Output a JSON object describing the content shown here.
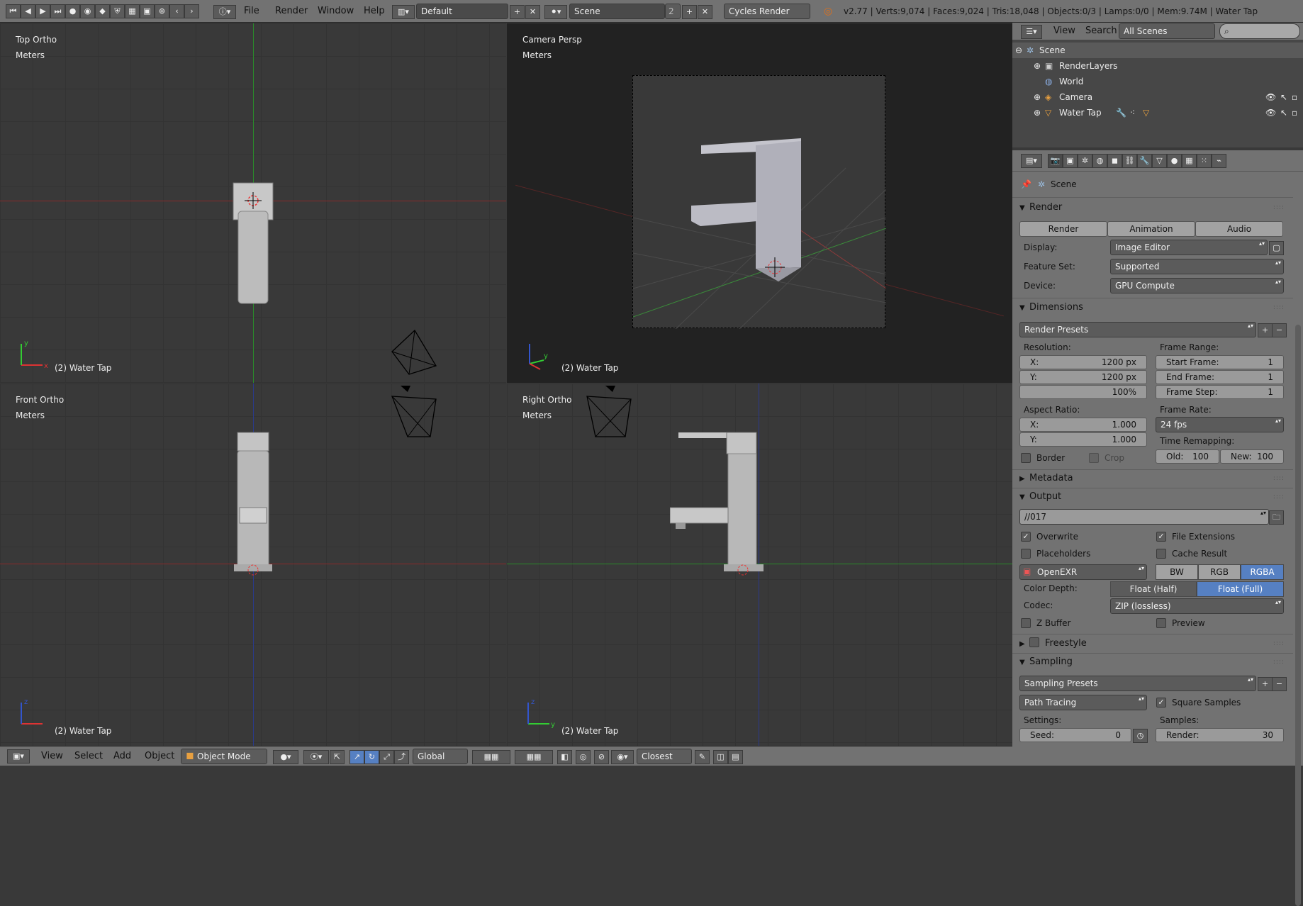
{
  "topbar": {
    "menus": [
      "File",
      "Render",
      "Window",
      "Help"
    ],
    "screen_layout": "Default",
    "scene_name": "Scene",
    "scene_users": "2",
    "render_engine": "Cycles Render",
    "stats": "v2.77 | Verts:9,074 | Faces:9,024 | Tris:18,048 | Objects:0/3 | Lamps:0/0 | Mem:9.74M | Water Tap"
  },
  "viewports": {
    "top_left": {
      "view": "Top Ortho",
      "units": "Meters",
      "object": "(2) Water Tap"
    },
    "top_right": {
      "view": "Camera Persp",
      "units": "Meters",
      "object": "(2) Water Tap"
    },
    "bottom_left": {
      "view": "Front Ortho",
      "units": "Meters",
      "object": "(2) Water Tap"
    },
    "bottom_right": {
      "view": "Right Ortho",
      "units": "Meters",
      "object": "(2) Water Tap"
    }
  },
  "bottombar": {
    "menus": [
      "View",
      "Select",
      "Add",
      "Object"
    ],
    "mode": "Object Mode",
    "orientation": "Global",
    "snap": "Closest"
  },
  "outliner": {
    "menus": [
      "View",
      "Search"
    ],
    "filter": "All Scenes",
    "items": [
      {
        "label": "Scene",
        "icon": "scene-icon"
      },
      {
        "label": "RenderLayers",
        "icon": "render-layers-icon"
      },
      {
        "label": "World",
        "icon": "world-icon"
      },
      {
        "label": "Camera",
        "icon": "camera-icon"
      },
      {
        "label": "Water Tap",
        "icon": "mesh-icon"
      }
    ]
  },
  "properties": {
    "context": "Scene",
    "render": {
      "title": "Render",
      "buttons": [
        "Render",
        "Animation",
        "Audio"
      ],
      "display_label": "Display:",
      "display": "Image Editor",
      "feature_label": "Feature Set:",
      "feature": "Supported",
      "device_label": "Device:",
      "device": "GPU Compute"
    },
    "dimensions": {
      "title": "Dimensions",
      "presets": "Render Presets",
      "resolution_label": "Resolution:",
      "res_x_k": "X:",
      "res_x": "1200 px",
      "res_y_k": "Y:",
      "res_y": "1200 px",
      "res_pct": "100%",
      "frame_range_label": "Frame Range:",
      "start_k": "Start Frame:",
      "start": "1",
      "end_k": "End Frame:",
      "end": "1",
      "step_k": "Frame Step:",
      "step": "1",
      "aspect_label": "Aspect Ratio:",
      "asp_x_k": "X:",
      "asp_x": "1.000",
      "asp_y_k": "Y:",
      "asp_y": "1.000",
      "frame_rate_label": "Frame Rate:",
      "fps": "24 fps",
      "time_remap_label": "Time Remapping:",
      "old_k": "Old:",
      "old": "100",
      "new_k": "New:",
      "new": "100",
      "border": "Border",
      "crop": "Crop"
    },
    "metadata": {
      "title": "Metadata"
    },
    "output": {
      "title": "Output",
      "path": "//017",
      "overwrite": "Overwrite",
      "file_ext": "File Extensions",
      "placeholders": "Placeholders",
      "cache": "Cache Result",
      "format": "OpenEXR",
      "channels": [
        "BW",
        "RGB",
        "RGBA"
      ],
      "color_depth_label": "Color Depth:",
      "depths": [
        "Float (Half)",
        "Float (Full)"
      ],
      "codec_label": "Codec:",
      "codec": "ZIP (lossless)",
      "zbuffer": "Z Buffer",
      "preview": "Preview"
    },
    "freestyle": {
      "title": "Freestyle"
    },
    "sampling": {
      "title": "Sampling",
      "presets": "Sampling Presets",
      "integrator": "Path Tracing",
      "square": "Square Samples",
      "settings_label": "Settings:",
      "samples_label": "Samples:",
      "seed_k": "Seed:",
      "seed": "0",
      "render_k": "Render:",
      "render": "30"
    }
  }
}
